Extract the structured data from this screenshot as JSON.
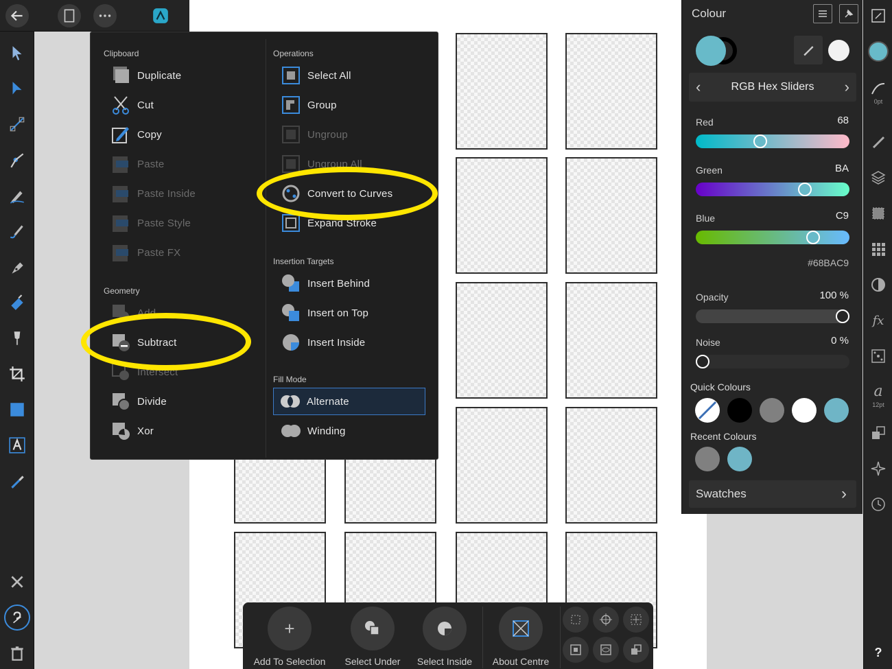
{
  "clipboard": {
    "title": "Clipboard",
    "items": [
      {
        "label": "Duplicate",
        "enabled": true,
        "icon": "duplicate-icon"
      },
      {
        "label": "Cut",
        "enabled": true,
        "icon": "scissors-icon"
      },
      {
        "label": "Copy",
        "enabled": true,
        "icon": "copy-icon"
      },
      {
        "label": "Paste",
        "enabled": false,
        "icon": "paste-icon"
      },
      {
        "label": "Paste Inside",
        "enabled": false,
        "icon": "paste-inside-icon"
      },
      {
        "label": "Paste Style",
        "enabled": false,
        "icon": "paste-style-icon"
      },
      {
        "label": "Paste FX",
        "enabled": false,
        "icon": "paste-fx-icon"
      }
    ]
  },
  "geometry": {
    "title": "Geometry",
    "items": [
      {
        "label": "Add",
        "enabled": false,
        "icon": "add-geometry-icon"
      },
      {
        "label": "Subtract",
        "enabled": true,
        "icon": "subtract-geometry-icon",
        "highlighted": true
      },
      {
        "label": "Intersect",
        "enabled": false,
        "icon": "intersect-geometry-icon"
      },
      {
        "label": "Divide",
        "enabled": true,
        "icon": "divide-geometry-icon"
      },
      {
        "label": "Xor",
        "enabled": true,
        "icon": "xor-geometry-icon"
      }
    ]
  },
  "operations": {
    "title": "Operations",
    "items": [
      {
        "label": "Select All",
        "enabled": true,
        "icon": "select-all-icon"
      },
      {
        "label": "Group",
        "enabled": true,
        "icon": "group-icon"
      },
      {
        "label": "Ungroup",
        "enabled": false,
        "icon": "ungroup-icon"
      },
      {
        "label": "Ungroup All",
        "enabled": false,
        "icon": "ungroup-all-icon"
      },
      {
        "label": "Convert to Curves",
        "enabled": true,
        "icon": "convert-to-curves-icon",
        "highlighted": true
      },
      {
        "label": "Expand Stroke",
        "enabled": true,
        "icon": "expand-stroke-icon"
      }
    ]
  },
  "insertion_targets": {
    "title": "Insertion Targets",
    "items": [
      {
        "label": "Insert Behind",
        "icon": "insert-behind-icon"
      },
      {
        "label": "Insert on Top",
        "icon": "insert-on-top-icon"
      },
      {
        "label": "Insert Inside",
        "icon": "insert-inside-icon"
      }
    ]
  },
  "fill_mode": {
    "title": "Fill Mode",
    "items": [
      {
        "label": "Alternate",
        "selected": true,
        "icon": "alternate-fill-icon"
      },
      {
        "label": "Winding",
        "selected": false,
        "icon": "winding-fill-icon"
      }
    ]
  },
  "colour_panel": {
    "title": "Colour",
    "mode": "RGB Hex Sliders",
    "sliders": [
      {
        "label": "Red",
        "value": "68",
        "fraction": 0.41
      },
      {
        "label": "Green",
        "value": "BA",
        "fraction": 0.73
      },
      {
        "label": "Blue",
        "value": "C9",
        "fraction": 0.79
      }
    ],
    "hex": "#68BAC9",
    "opacity": {
      "label": "Opacity",
      "value": "100 %",
      "fraction": 1.0
    },
    "noise": {
      "label": "Noise",
      "value": "0 %",
      "fraction": 0.0
    },
    "quick_colours_title": "Quick Colours",
    "quick_colours": [
      "none",
      "#000000",
      "#808080",
      "#ffffff",
      "#6fb5c6"
    ],
    "recent_colours_title": "Recent Colours",
    "recent_colours": [
      "#808080",
      "#6fb5c6"
    ],
    "swatches_label": "Swatches",
    "fill_colour": "#68BAC9"
  },
  "right_toolbar": {
    "stroke_width": "0pt",
    "font_size": "12pt"
  },
  "context_bar": {
    "items": [
      {
        "label": "Add To Selection"
      },
      {
        "label": "Select Under"
      },
      {
        "label": "Select Inside"
      },
      {
        "label": "About Centre"
      }
    ]
  },
  "help_label": "?"
}
